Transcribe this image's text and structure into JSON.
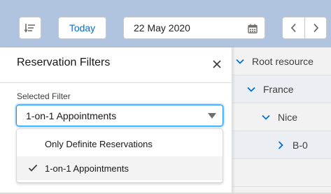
{
  "header": {
    "today_label": "Today",
    "date_value": "22 May 2020"
  },
  "panel": {
    "title": "Reservation Filters",
    "field_label": "Selected Filter",
    "selected_value": "1-on-1 Appointments",
    "options": [
      {
        "label": "Only Definite Reservations",
        "selected": false
      },
      {
        "label": "1-on-1 Appointments",
        "selected": true
      }
    ]
  },
  "tree": {
    "items": [
      {
        "label": "Root resource",
        "expanded": true
      },
      {
        "label": "France",
        "expanded": true
      },
      {
        "label": "Nice",
        "expanded": true
      },
      {
        "label": "B-0",
        "expanded": false
      }
    ]
  },
  "colors": {
    "accent": "#0070d2",
    "header_bg": "#b0c4df",
    "tree_bg": "#f3f2f2"
  }
}
